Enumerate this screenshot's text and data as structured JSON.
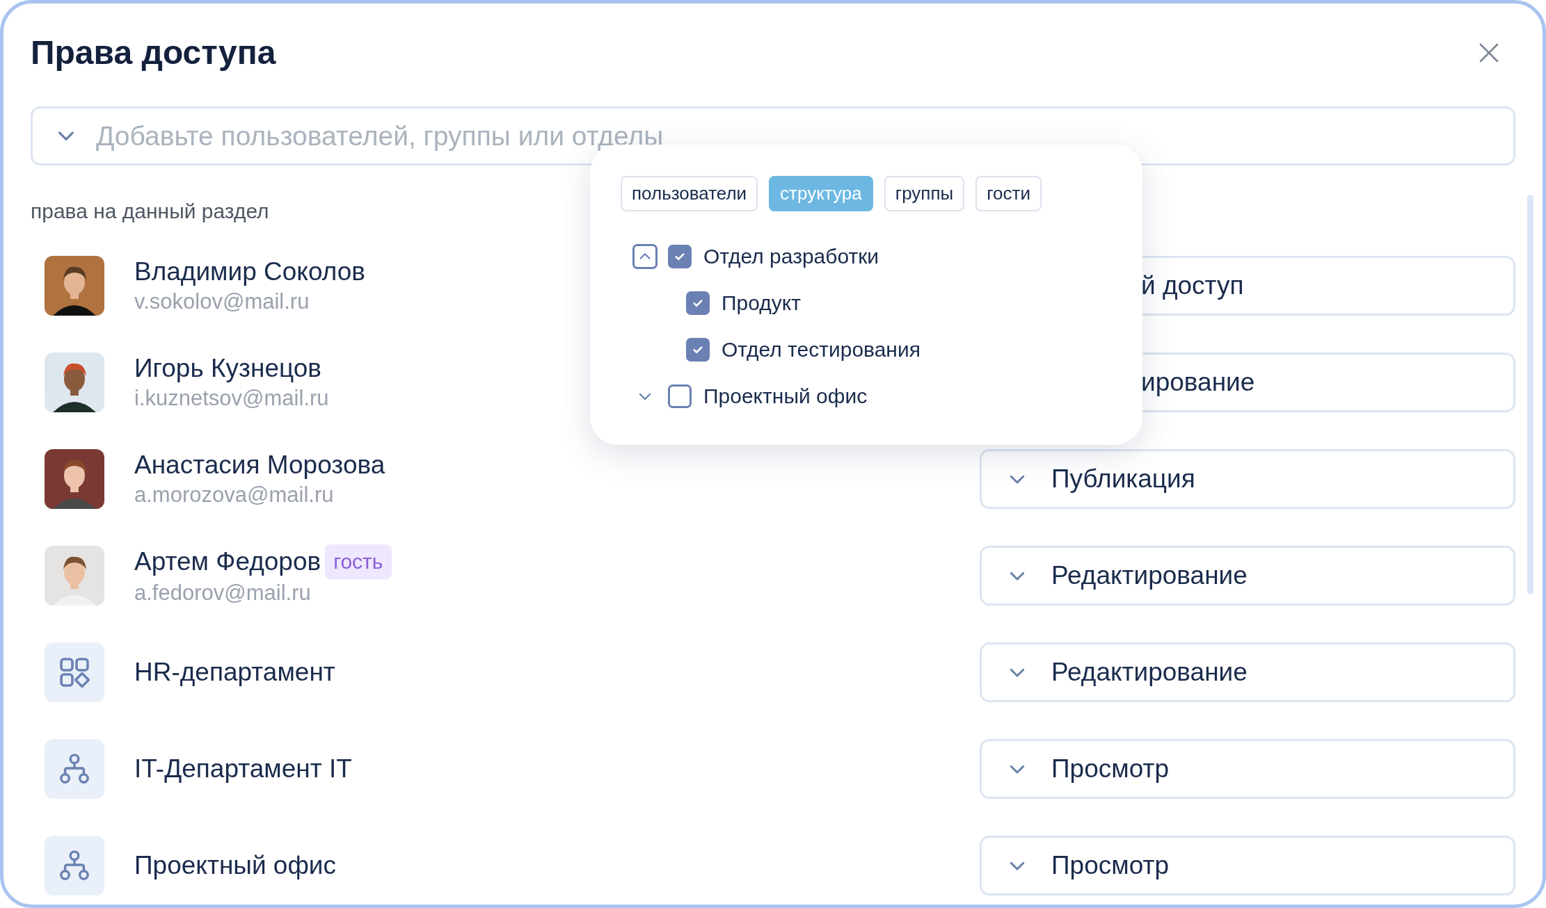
{
  "window": {
    "title": "Права доступа"
  },
  "search": {
    "placeholder": "Добавьте пользователей, группы или отделы"
  },
  "section_label": "права на данный раздел",
  "members": [
    {
      "kind": "person",
      "name": "Владимир Соколов",
      "email": "v.sokolov@mail.ru",
      "access": {
        "label": "й доступ",
        "covered": true
      }
    },
    {
      "kind": "person",
      "name": "Игорь Кузнецов",
      "email": "i.kuznetsov@mail.ru",
      "access": {
        "label": "ирование",
        "covered": true
      }
    },
    {
      "kind": "person",
      "name": "Анастасия Морозова",
      "email": "a.morozova@mail.ru",
      "access": {
        "label": "Публикация",
        "covered": false
      }
    },
    {
      "kind": "person",
      "name": "Артем Федоров",
      "badge": "гость",
      "email": "a.fedorov@mail.ru",
      "access": {
        "label": "Редактирование",
        "covered": false
      }
    },
    {
      "kind": "group",
      "name": "HR-департамент",
      "access": {
        "label": "Редактирование",
        "covered": false
      }
    },
    {
      "kind": "department",
      "name": "IT-Департамент IT",
      "access": {
        "label": "Просмотр",
        "covered": false
      }
    },
    {
      "kind": "department",
      "name": "Проектный офис",
      "access": {
        "label": "Просмотр",
        "covered": false
      }
    }
  ],
  "picker": {
    "tabs": [
      {
        "label": "пользователи",
        "selected": false
      },
      {
        "label": "структура",
        "selected": true
      },
      {
        "label": "группы",
        "selected": false
      },
      {
        "label": "гости",
        "selected": false
      }
    ],
    "tree": [
      {
        "label": "Отдел разработки",
        "checked": true,
        "expanded": true,
        "children": [
          {
            "label": "Продукт",
            "checked": true
          },
          {
            "label": "Отдел тестирования",
            "checked": true
          }
        ]
      },
      {
        "label": "Проектный офис",
        "checked": false,
        "expanded": false
      }
    ]
  }
}
